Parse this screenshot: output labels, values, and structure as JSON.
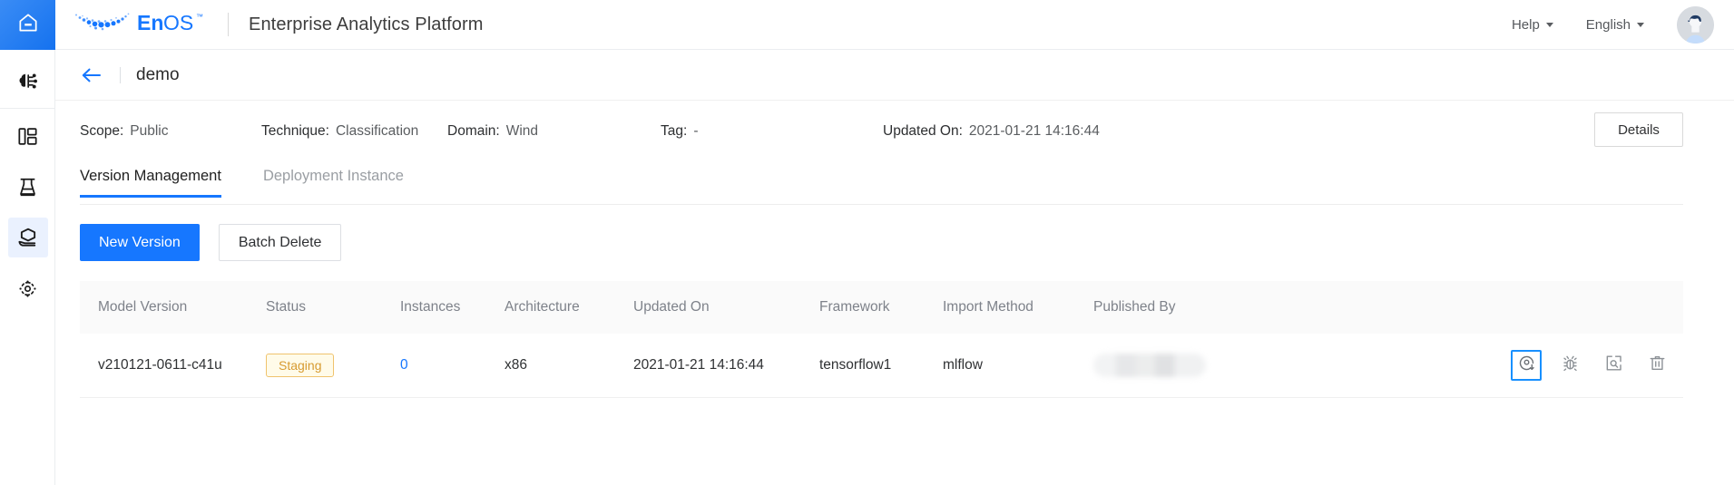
{
  "rail": {
    "home_icon": "home-icon",
    "items": [
      {
        "icon": "brain-ai-icon",
        "name": "ai-studio",
        "active": false
      },
      {
        "icon": "dashboard-layout-icon",
        "name": "workspace",
        "active": false
      },
      {
        "icon": "flask-lab-icon",
        "name": "experiments",
        "active": false
      },
      {
        "icon": "model-serving-icon",
        "name": "models",
        "active": true
      },
      {
        "icon": "settings-gear-icon",
        "name": "settings",
        "active": false
      }
    ]
  },
  "header": {
    "logo_text": "EnOS",
    "logo_tm": "™",
    "subtitle": "Enterprise Analytics Platform",
    "help_label": "Help",
    "language_label": "English",
    "avatar_name": "user-avatar"
  },
  "breadcrumb": {
    "back_icon": "back-arrow-icon",
    "title": "demo"
  },
  "meta": [
    {
      "key": "Scope:",
      "value": "Public"
    },
    {
      "key": "Technique:",
      "value": "Classification"
    },
    {
      "key": "Domain:",
      "value": "Wind"
    },
    {
      "key": "Tag:",
      "value": "-"
    },
    {
      "key": "Updated On:",
      "value": "2021-01-21 14:16:44"
    }
  ],
  "details_button": "Details",
  "tabs": [
    {
      "label": "Version Management",
      "active": true
    },
    {
      "label": "Deployment Instance",
      "active": false
    }
  ],
  "toolbar": {
    "new_version_label": "New Version",
    "batch_delete_label": "Batch Delete"
  },
  "table": {
    "columns": [
      "Model Version",
      "Status",
      "Instances",
      "Architecture",
      "Updated On",
      "Framework",
      "Import Method",
      "Published By",
      ""
    ],
    "rows": [
      {
        "model_version": "v210121-0611-c41u",
        "status": "Staging",
        "instances": "0",
        "architecture": "x86",
        "updated_on": "2021-01-21 14:16:44",
        "framework": "tensorflow1",
        "import_method": "mlflow",
        "published_by": "",
        "actions": [
          {
            "icon": "deploy-icon",
            "name": "deploy-version-button",
            "focused": true
          },
          {
            "icon": "bug-debug-icon",
            "name": "debug-version-button",
            "focused": false
          },
          {
            "icon": "inspect-preview-icon",
            "name": "preview-version-button",
            "focused": false
          },
          {
            "icon": "trash-delete-icon",
            "name": "delete-version-button",
            "focused": false
          }
        ]
      }
    ]
  },
  "colors": {
    "accent": "#1677ff",
    "rail_home": "#1572ef",
    "staging_border": "#f0c36d",
    "staging_text": "#d79b31",
    "staging_bg": "#fffbe9",
    "header_text": "#7e828a",
    "focus_ring": "#1890ff"
  }
}
